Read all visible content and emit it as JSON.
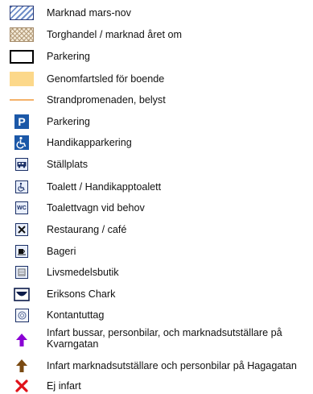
{
  "legend": {
    "items": [
      {
        "label": "Marknad mars-nov",
        "icon": "blue-hatched-area-icon"
      },
      {
        "label": "Torghandel / marknad året om",
        "icon": "crosshatched-area-icon"
      },
      {
        "label": "Parkering",
        "icon": "outlined-rectangle-icon"
      },
      {
        "label": "Genomfartsled för boende",
        "icon": "orange-filled-area-icon"
      },
      {
        "label": "Strandpromenaden, belyst",
        "icon": "orange-line-icon"
      },
      {
        "label": "Parkering",
        "icon": "parking-p-icon"
      },
      {
        "label": "Handikapparkering",
        "icon": "wheelchair-icon"
      },
      {
        "label": "Ställplats",
        "icon": "camper-van-icon"
      },
      {
        "label": "Toalett / Handikapptoalett",
        "icon": "accessible-toilet-icon"
      },
      {
        "label": "Toalettvagn vid behov",
        "icon": "wc-icon"
      },
      {
        "label": "Restaurang / café",
        "icon": "fork-knife-icon"
      },
      {
        "label": "Bageri",
        "icon": "bakery-icon"
      },
      {
        "label": "Livsmedelsbutik",
        "icon": "grocery-store-icon"
      },
      {
        "label": "Eriksons Chark",
        "icon": "eriksons-chark-logo-icon"
      },
      {
        "label": "Kontantuttag",
        "icon": "atm-icon"
      },
      {
        "label": "Infart bussar, personbilar, och marknadsutställare på Kvarngatan",
        "icon": "purple-arrow-up-icon"
      },
      {
        "label": "Infart marknadsutställare och personbilar på Hagagatan",
        "icon": "brown-arrow-up-icon"
      },
      {
        "label": "Ej infart",
        "icon": "red-x-icon"
      }
    ]
  },
  "colors": {
    "hatch_blue": "#6f8ec8",
    "fill_orange": "#fcd88a",
    "line_orange": "#f4b26a",
    "parking_blue": "#1b58a8",
    "arrow_purple": "#8a00d4",
    "arrow_brown": "#7a4a12",
    "no_entry_red": "#e0121a"
  }
}
